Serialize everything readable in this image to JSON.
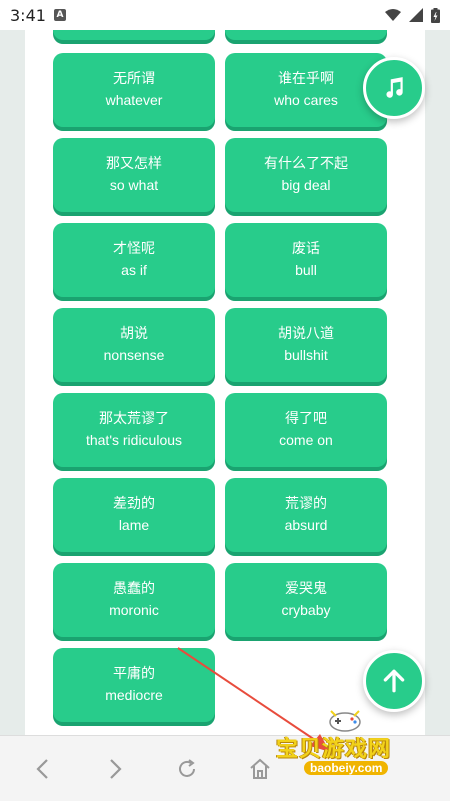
{
  "status_bar": {
    "time": "3:41",
    "notification_letter": "A"
  },
  "phrases": [
    {
      "zh": "无所谓",
      "en": "whatever"
    },
    {
      "zh": "谁在乎啊",
      "en": "who cares"
    },
    {
      "zh": "那又怎样",
      "en": "so what"
    },
    {
      "zh": "有什么了不起",
      "en": "big deal"
    },
    {
      "zh": "才怪呢",
      "en": "as if"
    },
    {
      "zh": "废话",
      "en": "bull"
    },
    {
      "zh": "胡说",
      "en": "nonsense"
    },
    {
      "zh": "胡说八道",
      "en": "bullshit"
    },
    {
      "zh": "那太荒谬了",
      "en": "that's ridiculous"
    },
    {
      "zh": "得了吧",
      "en": "come on"
    },
    {
      "zh": "差劲的",
      "en": "lame"
    },
    {
      "zh": "荒谬的",
      "en": "absurd"
    },
    {
      "zh": "愚蠢的",
      "en": "moronic"
    },
    {
      "zh": "爱哭鬼",
      "en": "crybaby"
    },
    {
      "zh": "平庸的",
      "en": "mediocre"
    }
  ],
  "fab": {
    "music_icon": "music-note-icon",
    "up_icon": "arrow-up-icon"
  },
  "bottom_nav": {
    "icons": [
      "back-icon",
      "forward-icon",
      "refresh-icon",
      "home-icon"
    ]
  },
  "watermark": {
    "text": "宝贝游戏网",
    "url": "baobeiy.com"
  },
  "colors": {
    "card": "#28cc8b",
    "card_shadow": "#1aa370",
    "watermark": "#f2d21a"
  }
}
